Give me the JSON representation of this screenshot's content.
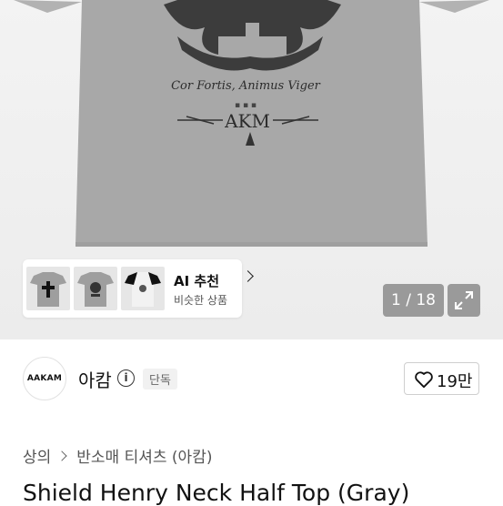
{
  "product_image": {
    "print_text_line1": "Cor Fortis, Animus Viger",
    "print_text_line2": "AKM",
    "pager": "1 / 18"
  },
  "ai_recommend": {
    "title": "AI 추천",
    "subtitle": "비슷한 상품"
  },
  "shop": {
    "logo_text": "AAKAM",
    "name": "아캄",
    "badge": "단독",
    "like_count": "19만"
  },
  "breadcrumb": {
    "items": [
      "상의",
      "반소매 티셔츠 (아캄)"
    ]
  },
  "product": {
    "title": "Shield Henry Neck Half Top (Gray)"
  },
  "colors": {
    "shirt": "#a9a9a9",
    "overlay": "#9a9a9a",
    "badge_bg": "#f1f1f1"
  }
}
